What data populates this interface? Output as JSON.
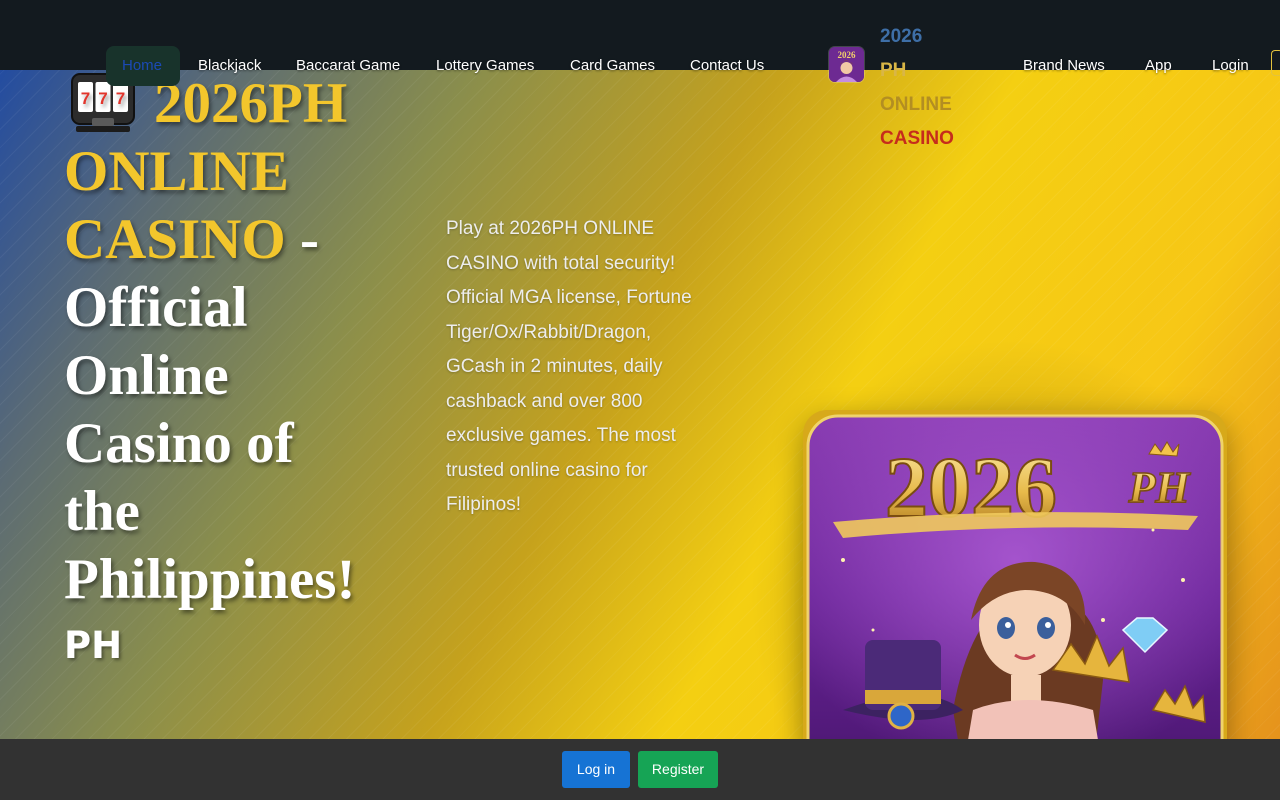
{
  "nav": {
    "items": [
      {
        "label": "Home"
      },
      {
        "label": "Blackjack"
      },
      {
        "label": "Baccarat Game"
      },
      {
        "label": "Lottery Games"
      },
      {
        "label": "Card Games"
      },
      {
        "label": "Contact Us"
      },
      {
        "label": "Brand News"
      },
      {
        "label": "App"
      },
      {
        "label": "Login"
      }
    ],
    "brand": {
      "line1_prefix": "2026",
      "line1_suffix": "PH",
      "line2": "ONLINE",
      "line3": "CASINO",
      "logo_icon": "brand-logo-icon"
    }
  },
  "hero": {
    "icon": "slot-machine-icon",
    "title_gold_1": "2026PH",
    "title_gold_2": "ONLINE",
    "title_gold_3": "CASINO",
    "title_dash": " -",
    "title_rest_1": "Official",
    "title_rest_2": "Online",
    "title_rest_3": "Casino of",
    "title_rest_4": "the",
    "title_rest_5": "Philippines!",
    "subtitle": "PH",
    "description": "Play at 2026PH ONLINE CASINO with total security! Official MGA license, Fortune Tiger/Ox/Rabbit/Dragon, GCash in 2 minutes, daily cashback and over 800 exclusive games. The most trusted online casino for Filipinos!",
    "promo": {
      "logo_number": "2026",
      "logo_suffix": "PH"
    }
  },
  "bottom_bar": {
    "login_label": "Log in",
    "register_label": "Register"
  },
  "colors": {
    "header_bg": "#131a1f",
    "gold": "#f3c62c",
    "login_button": "#1673d4",
    "register_button": "#16a455",
    "bottom_bar_bg": "#323232"
  }
}
